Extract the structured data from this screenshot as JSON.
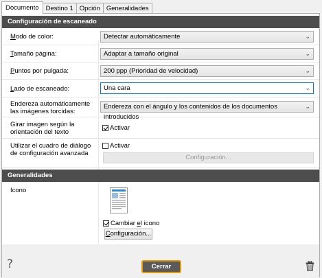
{
  "tabs": [
    "Documento",
    "Destino 1",
    "Opción",
    "Generalidades"
  ],
  "scan_section": {
    "title": "Configuración de escaneado",
    "color_mode": {
      "label_u": "M",
      "label_rest": "odo de color:",
      "value": "Detectar automáticamente"
    },
    "page_size": {
      "label_u": "T",
      "label_rest": "amaño página:",
      "value": "Adaptar a tamaño original"
    },
    "dpi": {
      "label_u": "P",
      "label_rest": "untos por pulgada:",
      "value": "200 ppp (Prioridad de velocidad)"
    },
    "scan_side": {
      "label_u": "L",
      "label_rest": "ado de escaneado:",
      "value": "Una cara"
    },
    "deskew": {
      "label_line1": "Endereza automáticamente",
      "label_line2": "las imágenes torcidas:",
      "value": "Endereza con el ángulo y los contenidos de los documentos introducidos"
    },
    "rotate": {
      "label_line1": "Girar imagen según la",
      "label_line2": "orientación del texto",
      "check_label": "Activar",
      "checked": true
    },
    "advanced": {
      "label_line1": "Utilizar el cuadro de diálogo",
      "label_line2": "de configuración avanzada",
      "check_label": "Activar",
      "checked": false,
      "button": "Configuración..."
    }
  },
  "general_section": {
    "title": "Generalidades",
    "icon_label": "Icono",
    "change_icon": {
      "label_pre": "Cambiar ",
      "label_u": "e",
      "label_post": "l icono",
      "checked": true
    },
    "config_button": {
      "label_u": "C",
      "label_rest": "onfiguración..."
    }
  },
  "footer": {
    "help": "?",
    "close": "Cerrar"
  }
}
